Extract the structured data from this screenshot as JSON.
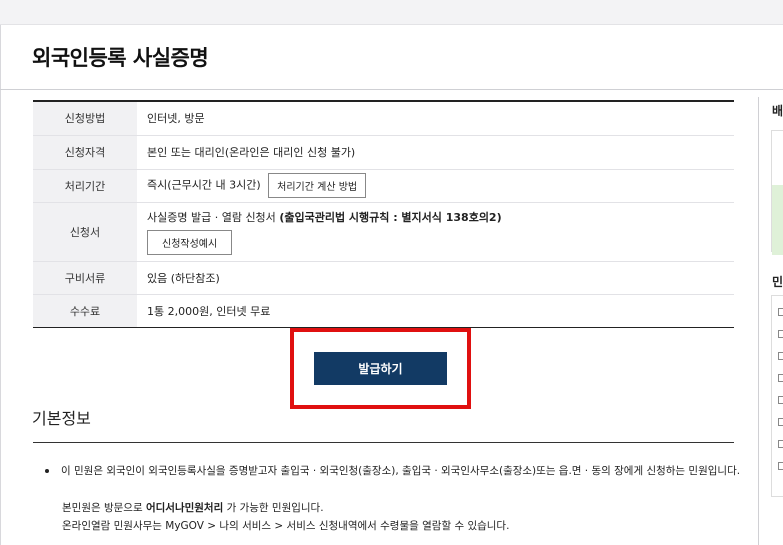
{
  "page_title": "외국인등록 사실증명",
  "info_rows": [
    {
      "label": "신청방법",
      "value": "인터넷, 방문"
    },
    {
      "label": "신청자격",
      "value": "본인 또는 대리인(온라인은 대리인 신청 불가)"
    },
    {
      "label": "처리기간",
      "value": "즉시(근무시간 내 3시간)",
      "button": "처리기간 계산 방법"
    },
    {
      "label": "신청서",
      "value_prefix": "사실증명 발급 · 열람 신청서 ",
      "value_bold": "(출입국관리법 시행규칙 : 별지서식 138호의2)",
      "button": "신청작성예시"
    },
    {
      "label": "구비서류",
      "value": "있음 (하단참조)"
    },
    {
      "label": "수수료",
      "value": "1통 2,000원, 인터넷 무료"
    }
  ],
  "issue_button": "발급하기",
  "section_title": "기본정보",
  "bullet_text": "이 민원은 외국인이 외국인등록사실을 증명받고자 출입국 · 외국인청(출장소), 출입국 · 외국인사무소(출장소)또는 읍.면 · 동의 장에게 신청하는 민원입니다.",
  "note1": {
    "prefix": "본민원은 방문으로 ",
    "bold": "어디서나민원처리",
    "suffix": " 가 가능한 민원입니다."
  },
  "note2": "온라인열람 민원사무는 MyGOV > 나의 서비스 > 서비스 신청내역에서 수령물을 열람할 수 있습니다.",
  "sidebar": {
    "heading1": "배",
    "heading2": "민"
  },
  "colors": {
    "primary_button": "#123a64",
    "highlight": "#e01010",
    "sidebar_green": "#dff1d8"
  }
}
